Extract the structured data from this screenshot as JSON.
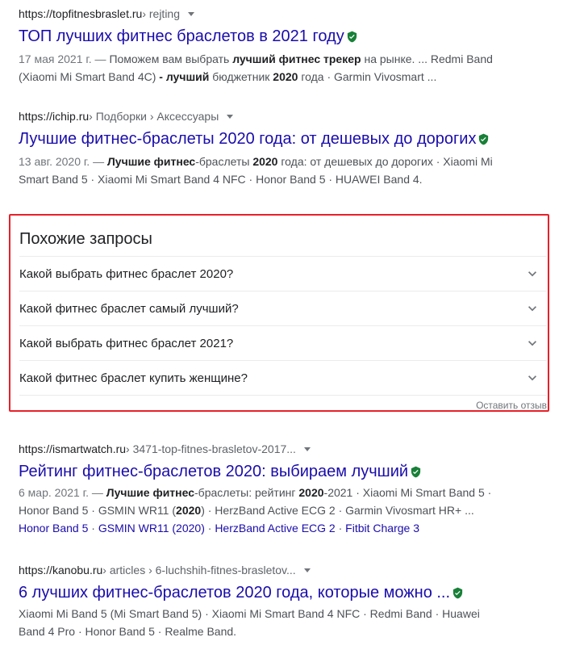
{
  "results_top": [
    {
      "domain": "https://topfitnesbraslet.ru",
      "path": " › rejting",
      "title": "ТОП лучших фитнес браслетов в 2021 году",
      "snippet_lines": [
        [
          {
            "t": "17 мая 2021 г. — ",
            "cls": "date"
          },
          {
            "t": "Поможем вам выбрать "
          },
          {
            "t": "лучший фитнес трекер",
            "b": true
          },
          {
            "t": " на рынке. ... Redmi Band"
          }
        ],
        [
          {
            "t": "(Xiaomi Mi Smart Band 4C) "
          },
          {
            "t": "- лучший",
            "b": true
          },
          {
            "t": " бюджетник "
          },
          {
            "t": "2020",
            "b": true
          },
          {
            "t": " года · Garmin Vivosmart ..."
          }
        ]
      ]
    },
    {
      "domain": "https://ichip.ru",
      "path": " › Подборки › Аксессуары",
      "title": "Лучшие фитнес-браслеты 2020 года: от дешевых до дорогих",
      "snippet_lines": [
        [
          {
            "t": "13 авг. 2020 г. — ",
            "cls": "date"
          },
          {
            "t": "Лучшие фитнес",
            "b": true
          },
          {
            "t": "-браслеты "
          },
          {
            "t": "2020",
            "b": true
          },
          {
            "t": " года: от дешевых до дорогих · Xiaomi Mi"
          }
        ],
        [
          {
            "t": "Smart Band 5 · Xiaomi Mi Smart Band 4 NFC · Honor Band 5 · HUAWEI Band 4."
          }
        ]
      ]
    }
  ],
  "related": {
    "heading": "Похожие запросы",
    "items": [
      "Какой выбрать фитнес браслет 2020?",
      "Какой фитнес браслет самый лучший?",
      "Какой выбрать фитнес браслет 2021?",
      "Какой фитнес браслет купить женщине?"
    ],
    "feedback": "Оставить отзыв"
  },
  "results_bottom": [
    {
      "domain": "https://ismartwatch.ru",
      "path": " › 3471-top-fitnes-brasletov-2017...",
      "title": "Рейтинг фитнес-браслетов 2020: выбираем лучший",
      "snippet_lines": [
        [
          {
            "t": "6 мар. 2021 г. — ",
            "cls": "date"
          },
          {
            "t": "Лучшие фитнес",
            "b": true
          },
          {
            "t": "-браслеты: рейтинг "
          },
          {
            "t": "2020",
            "b": true
          },
          {
            "t": "-2021 · Xiaomi Mi Smart Band 5 ·"
          }
        ],
        [
          {
            "t": "Honor Band 5 · GSMIN WR11 ("
          },
          {
            "t": "2020",
            "b": true
          },
          {
            "t": ") · HerzBand Active ECG 2 · Garmin Vivosmart HR+ ..."
          }
        ]
      ],
      "sitelinks": [
        "Honor Band 5",
        "GSMIN WR11 (2020)",
        "HerzBand Active ECG 2",
        "Fitbit Charge 3"
      ]
    },
    {
      "domain": "https://kanobu.ru",
      "path": " › articles › 6-luchshih-fitnes-brasletov...",
      "title": "6 лучших фитнес-браслетов 2020 года, которые можно ...",
      "snippet_lines": [
        [
          {
            "t": "Xiaomi Mi Band 5 (Mi Smart Band 5) · Xiaomi Mi Smart Band 4 NFC · Redmi Band · Huawei"
          }
        ],
        [
          {
            "t": "Band 4 Pro · Honor Band 5 · Realme Band."
          }
        ]
      ]
    }
  ],
  "colors": {
    "link": "#1a0dab",
    "verified": "#188038",
    "highlight_border": "#e8202a"
  },
  "icons": {
    "verified": "shield-check-icon",
    "expand": "chevron-down-icon",
    "menu": "caret-down-icon"
  }
}
